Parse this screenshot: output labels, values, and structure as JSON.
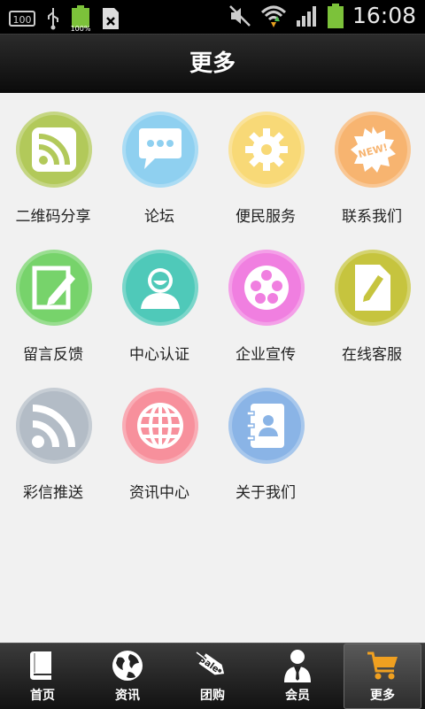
{
  "status_bar": {
    "time": "16:08",
    "sim_label": "100",
    "battery_small_label": "100%",
    "icons": [
      "sim-icon",
      "usb-icon",
      "battery-small-icon",
      "sd-card-icon",
      "mute-icon",
      "wifi-icon",
      "signal-icon",
      "battery-icon"
    ]
  },
  "header": {
    "title": "更多"
  },
  "grid": {
    "items": [
      {
        "label": "二维码分享",
        "icon": "rss-icon",
        "color": "#b2c95a"
      },
      {
        "label": "论坛",
        "icon": "chat-icon",
        "color": "#8fd0f0"
      },
      {
        "label": "便民服务",
        "icon": "gear-icon",
        "color": "#f8d977"
      },
      {
        "label": "联系我们",
        "icon": "new-badge-icon",
        "color": "#f7b470"
      },
      {
        "label": "留言反馈",
        "icon": "edit-icon",
        "color": "#77d36b"
      },
      {
        "label": "中心认证",
        "icon": "user-icon",
        "color": "#4fc9b9"
      },
      {
        "label": "企业宣传",
        "icon": "film-reel-icon",
        "color": "#f07fe0"
      },
      {
        "label": "在线客服",
        "icon": "document-edit-icon",
        "color": "#c6c43e"
      },
      {
        "label": "彩信推送",
        "icon": "rss-icon",
        "color": "#b3bcc6"
      },
      {
        "label": "资讯中心",
        "icon": "globe-icon",
        "color": "#f7909c"
      },
      {
        "label": "关于我们",
        "icon": "contacts-icon",
        "color": "#8ab4e6"
      }
    ]
  },
  "bottom_nav": {
    "items": [
      {
        "label": "首页",
        "icon": "book-icon"
      },
      {
        "label": "资讯",
        "icon": "globe-icon"
      },
      {
        "label": "团购",
        "icon": "sale-tag-icon",
        "tag_text": "Sale"
      },
      {
        "label": "会员",
        "icon": "member-icon"
      },
      {
        "label": "更多",
        "icon": "cart-icon"
      }
    ],
    "active_index": 4
  }
}
